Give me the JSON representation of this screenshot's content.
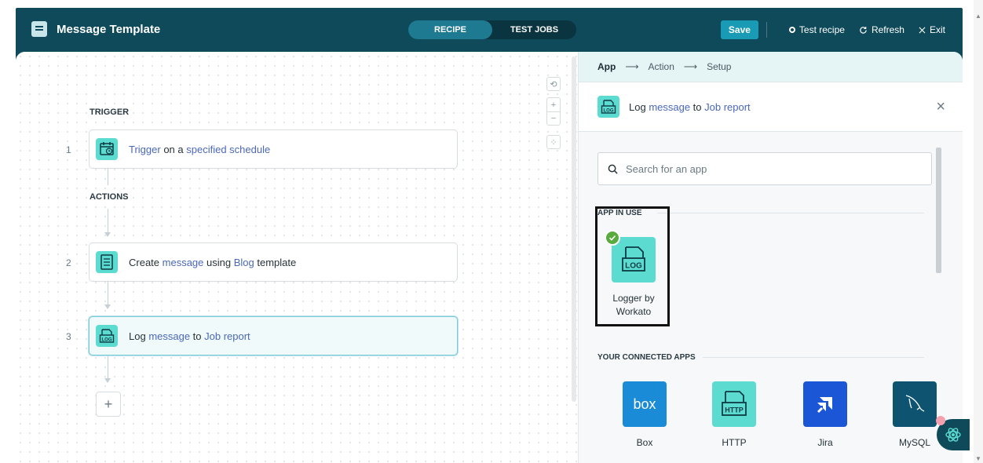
{
  "header": {
    "title": "Message Template",
    "tabs": [
      {
        "label": "RECIPE",
        "active": true
      },
      {
        "label": "TEST JOBS",
        "active": false
      }
    ],
    "save_label": "Save",
    "test_recipe_label": "Test recipe",
    "refresh_label": "Refresh",
    "exit_label": "Exit"
  },
  "canvas": {
    "trigger_label": "TRIGGER",
    "actions_label": "ACTIONS",
    "steps": [
      {
        "number": "1",
        "icon": "calendar-clock-icon",
        "parts": [
          "Trigger",
          " on a ",
          "specified schedule"
        ]
      },
      {
        "number": "2",
        "icon": "document-template-icon",
        "parts": [
          "Create ",
          "message",
          " using ",
          "Blog",
          " template"
        ]
      },
      {
        "number": "3",
        "icon": "log-icon",
        "parts": [
          "Log ",
          "message",
          " to ",
          "Job report"
        ]
      }
    ],
    "add_step_label": "+"
  },
  "panel": {
    "wizard_steps": [
      "App",
      "Action",
      "Setup"
    ],
    "wizard_arrow": "⟶",
    "selected": {
      "parts": [
        "Log ",
        "message",
        " to ",
        "Job report"
      ]
    },
    "close_label": "×",
    "search_placeholder": "Search for an app",
    "app_in_use_title": "APP IN USE",
    "app_in_use": {
      "line1": "Logger by",
      "line2": "Workato"
    },
    "connected_title": "YOUR CONNECTED APPS",
    "connected_apps": [
      {
        "name": "Box",
        "color": "#1a8bd6"
      },
      {
        "name": "HTTP",
        "color": "#5cdcd0"
      },
      {
        "name": "Jira",
        "color": "#1a56d6"
      },
      {
        "name": "MySQL",
        "color": "#0e5470"
      }
    ]
  },
  "colors": {
    "header_bg": "#0e4a5a",
    "accent": "#1a9bb5",
    "tile_teal": "#5cdcd0",
    "link": "#4a68b8"
  }
}
